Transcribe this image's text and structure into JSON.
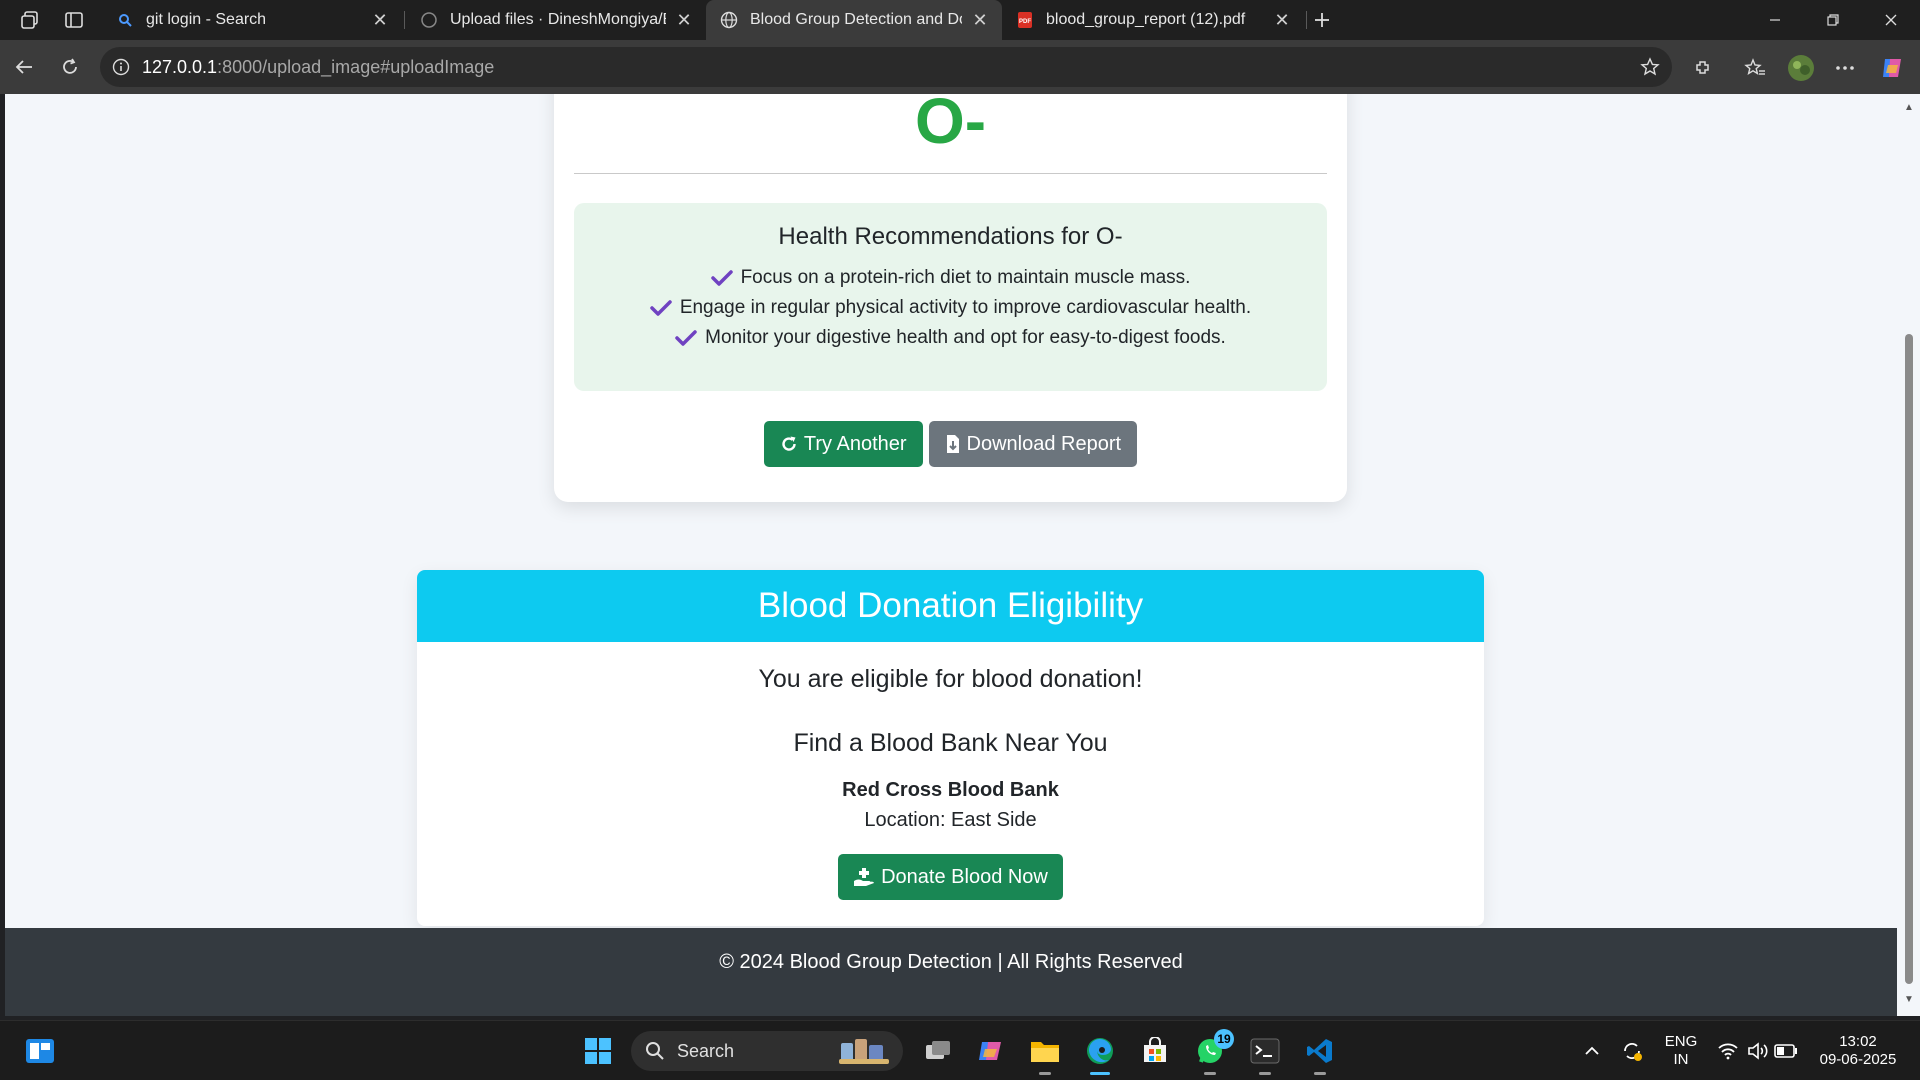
{
  "browser": {
    "tabs": [
      {
        "title": "git login - Search",
        "icon": "search-icon"
      },
      {
        "title": "Upload files · DineshMongiya/Blo",
        "icon": "github-icon"
      },
      {
        "title": "Blood Group Detection and Dona",
        "icon": "globe-icon",
        "active": true
      },
      {
        "title": "blood_group_report (12).pdf",
        "icon": "pdf-icon"
      }
    ],
    "url_host": "127.0.0.1",
    "url_rest": ":8000/upload_image#uploadImage"
  },
  "result": {
    "blood_type": "O-",
    "reco_title": "Health Recommendations for O-",
    "recommendations": [
      "Focus on a protein-rich diet to maintain muscle mass.",
      "Engage in regular physical activity to improve cardiovascular health.",
      "Monitor your digestive health and opt for easy-to-digest foods."
    ],
    "try_another_label": "Try Another",
    "download_label": "Download Report"
  },
  "eligibility": {
    "heading": "Blood Donation Eligibility",
    "message": "You are eligible for blood donation!",
    "bank_title": "Find a Blood Bank Near You",
    "bank_name": "Red Cross Blood Bank",
    "bank_location": "Location: East Side",
    "donate_label": "Donate Blood Now"
  },
  "footer": {
    "text": "© 2024 Blood Group Detection | All Rights Reserved"
  },
  "taskbar": {
    "search_label": "Search",
    "whatsapp_badge": "19",
    "lang_line1": "ENG",
    "lang_line2": "IN",
    "time": "13:02",
    "date": "09-06-2025"
  },
  "colors": {
    "accent_green": "#28a745",
    "button_green": "#198754",
    "button_grey": "#6c757d",
    "header_cyan": "#0dcaf0",
    "reco_bg": "#e8f5ec",
    "check_purple": "#6f42c1",
    "footer_bg": "#343a40"
  }
}
